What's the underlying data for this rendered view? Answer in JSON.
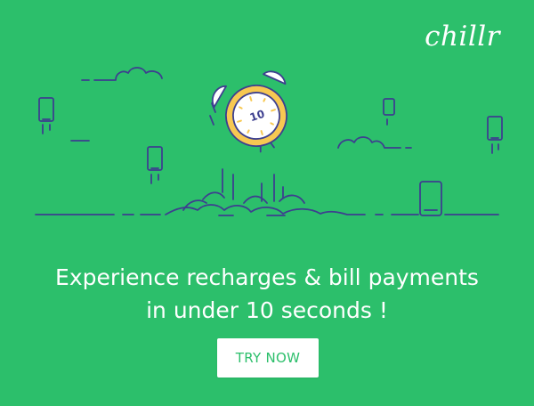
{
  "brand": {
    "logo_text": "chillr"
  },
  "timer": {
    "value": "10"
  },
  "headline": {
    "line1": "Experience recharges & bill payments",
    "line2": "in under 10 seconds !"
  },
  "cta": {
    "label": "TRY NOW"
  },
  "colors": {
    "background": "#2cbf6b",
    "line_art": "#3d3f8f",
    "clock_face": "#ffffff",
    "clock_rim": "#f7c852",
    "text": "#ffffff",
    "button_text": "#2cbf6b"
  },
  "icons": [
    "alarm-clock-icon",
    "phone-icon",
    "cloud-icon"
  ]
}
